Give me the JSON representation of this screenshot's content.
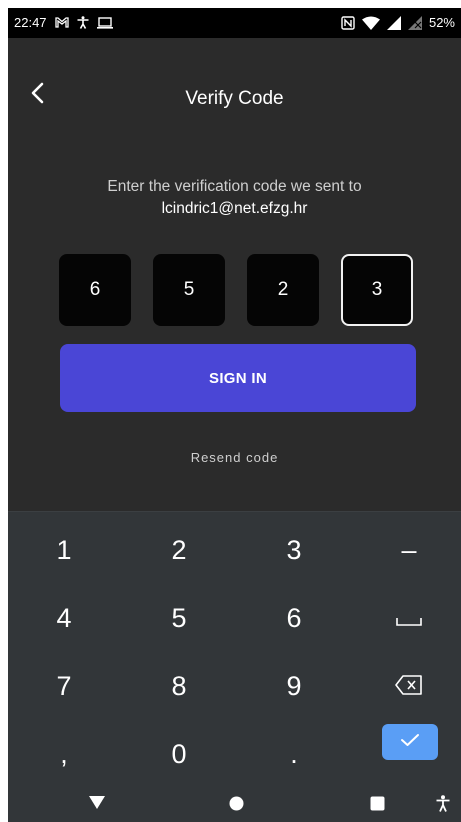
{
  "status_bar": {
    "time": "22:47",
    "battery": "52%",
    "icons_left": [
      "gmail-icon",
      "accessibility-icon",
      "laptop-icon"
    ],
    "icons_right": [
      "nfc-icon",
      "wifi-icon",
      "signal-icon",
      "no-sim-icon"
    ]
  },
  "header": {
    "title": "Verify Code",
    "back_icon": "chevron-left-icon"
  },
  "prompt": {
    "text": "Enter the verification code we sent to",
    "email": "lcindric1@net.efzg.hr"
  },
  "code": {
    "digits": [
      "6",
      "5",
      "2",
      "3"
    ],
    "active_index": 3
  },
  "signin_button": {
    "label": "SIGN IN",
    "color": "#4a46d6"
  },
  "resend_link": {
    "label": "Resend code"
  },
  "keyboard": {
    "rows": [
      [
        "1",
        "2",
        "3",
        "–"
      ],
      [
        "4",
        "5",
        "6",
        "␣"
      ],
      [
        "7",
        "8",
        "9",
        "⌫"
      ],
      [
        ",",
        "0",
        ".",
        "✓"
      ]
    ],
    "done_color": "#5a9ef5"
  },
  "nav_bar": {
    "icons": [
      "back-triangle-icon",
      "home-circle-icon",
      "recents-square-icon",
      "accessibility-icon"
    ]
  }
}
